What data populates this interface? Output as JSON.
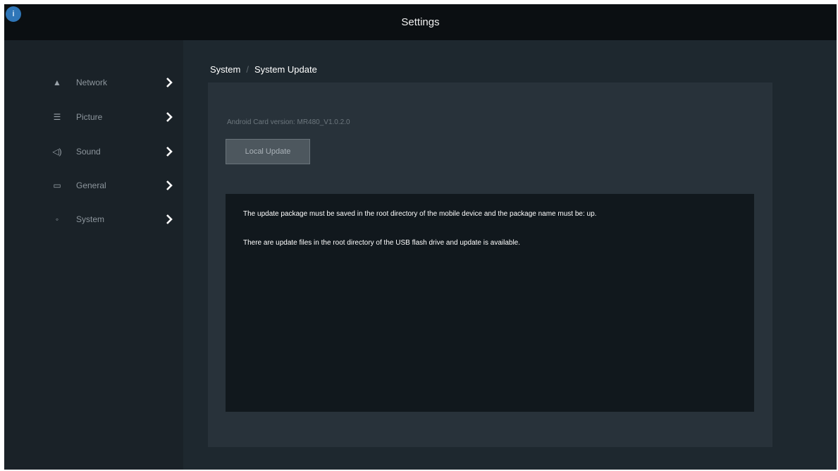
{
  "app": {
    "title": "Settings",
    "logo_glyph": "i",
    "logo_icon": "info-icon"
  },
  "sidebar": {
    "items": [
      {
        "label": "Network",
        "icon": "wifi-icon",
        "glyph": "▲"
      },
      {
        "label": "Picture",
        "icon": "picture-icon",
        "glyph": "☰"
      },
      {
        "label": "Sound",
        "icon": "speaker-icon",
        "glyph": "◁)"
      },
      {
        "label": "General",
        "icon": "general-icon",
        "glyph": "▭"
      },
      {
        "label": "System",
        "icon": "system-icon",
        "glyph": "◦"
      }
    ]
  },
  "breadcrumb": {
    "parent": "System",
    "separator": "/",
    "current": "System Update"
  },
  "update": {
    "version_text": "Android Card version: MR480_V1.0.2.0",
    "local_update_label": "Local Update",
    "messages": [
      "The update package must be saved in the root directory of the mobile device and the package name must be: up.",
      "There are update files in the root directory of the USB flash drive and update is available."
    ]
  },
  "colors": {
    "titlebar": "#0b0f12",
    "sidebar": "#1a2228",
    "content": "#1e282f",
    "panel": "#28323a",
    "message_box": "#11181d",
    "accent": "#2f76b8"
  }
}
